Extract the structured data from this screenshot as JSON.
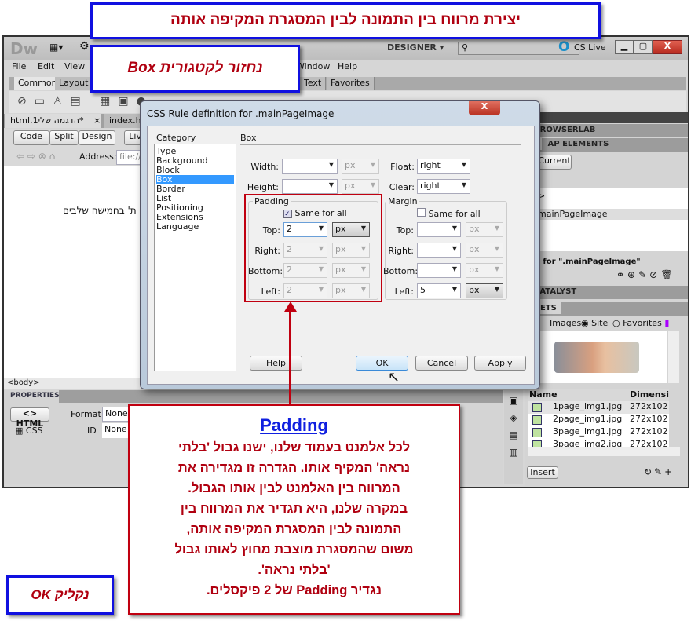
{
  "callouts": {
    "top": "יצירת מרווח בין התמונה לבין המסגרת המקיפה אותה",
    "box": "נחזור לקטגורית Box",
    "ok": "נקליק OK",
    "padding_title": "Padding",
    "padding_lines": [
      "לכל אלמנט בעמוד שלנו, ישנו גבול 'בלתי",
      "נראה' המקיף אותו. הגדרה זו מגדירה את",
      "המרווח בין האלמנט לבין אותו הגבול.",
      "במקרה שלנו, היא תגדיר את המרווח בין",
      "התמונה לבין המסגרת המקיפה אותה,",
      "משום שהמסגרת מוצבת מחוץ לאותו גבול",
      "'בלתי נראה'.",
      "נגדיר Padding של 2 פיקסלים."
    ],
    "colors": {
      "blue_border": "#1010e0",
      "red_border": "#c00010",
      "text_red": "#b00010",
      "link_blue": "#1020e0"
    }
  },
  "app": {
    "logo": "Dw",
    "workspace": "DESIGNER",
    "cs_live": "CS Live",
    "search_placeholder": ""
  },
  "menu": [
    "File",
    "Edit",
    "View",
    "Window",
    "Help"
  ],
  "insert_tabs": [
    "Common",
    "Layout",
    "Text",
    "Favorites"
  ],
  "doc_tabs": [
    {
      "label": "*הדגמה שלי1.html",
      "close": "×"
    },
    {
      "label": "index.htm"
    }
  ],
  "view_buttons": [
    "Code",
    "Split",
    "Design",
    "Live"
  ],
  "address": {
    "label": "Address:",
    "value": "file:///"
  },
  "design_text": "ת' בחמישה שלבים",
  "tag_selector": "<body>",
  "properties": {
    "title": "PROPERTIES",
    "html": "HTML",
    "css": "CSS",
    "format_label": "Format",
    "format_value": "None",
    "id_label": "ID",
    "id_value": "None"
  },
  "right_panel": {
    "browserlab": "BROWSERLAB",
    "css_tab": "ES",
    "ap_tab": "AP ELEMENTS",
    "current": "Current",
    "rule_tag": ">",
    "rule_selected": "mainPageImage",
    "props_for": "s for \".mainPageImage\"",
    "catalyst": "CATALYST",
    "assets": "SSETS",
    "images_label": "Images:",
    "site": "Site",
    "favorites": "Favorites",
    "col_name": "Name",
    "col_dim": "Dimensio",
    "files": [
      {
        "name": "1page_img1.jpg",
        "dim": "272x102"
      },
      {
        "name": "2page_img1.jpg",
        "dim": "272x102"
      },
      {
        "name": "3page_img1.jpg",
        "dim": "272x102"
      },
      {
        "name": "3page_img2.jpg",
        "dim": "272x102"
      }
    ],
    "insert": "Insert"
  },
  "dialog": {
    "title": "CSS Rule definition for .mainPageImage",
    "category_label": "Category",
    "categories": [
      "Type",
      "Background",
      "Block",
      "Box",
      "Border",
      "List",
      "Positioning",
      "Extensions",
      "Language"
    ],
    "selected_category": "Box",
    "section": "Box",
    "width_label": "Width:",
    "width": "",
    "width_unit": "px",
    "height_label": "Height:",
    "height": "",
    "height_unit": "px",
    "float_label": "Float:",
    "float": "right",
    "clear_label": "Clear:",
    "clear": "right",
    "padding": {
      "legend": "Padding",
      "same": "Same for all",
      "same_checked": true,
      "rows": [
        {
          "label": "Top:",
          "value": "2",
          "unit": "px"
        },
        {
          "label": "Right:",
          "value": "2",
          "unit": "px"
        },
        {
          "label": "Bottom:",
          "value": "2",
          "unit": "px"
        },
        {
          "label": "Left:",
          "value": "2",
          "unit": "px"
        }
      ]
    },
    "margin": {
      "legend": "Margin",
      "same": "Same for all",
      "same_checked": false,
      "rows": [
        {
          "label": "Top:",
          "value": "",
          "unit": "px"
        },
        {
          "label": "Right:",
          "value": "",
          "unit": "px"
        },
        {
          "label": "Bottom:",
          "value": "",
          "unit": "px"
        },
        {
          "label": "Left:",
          "value": "5",
          "unit": "px"
        }
      ]
    },
    "buttons": {
      "help": "Help",
      "ok": "OK",
      "cancel": "Cancel",
      "apply": "Apply"
    },
    "close": "X"
  }
}
